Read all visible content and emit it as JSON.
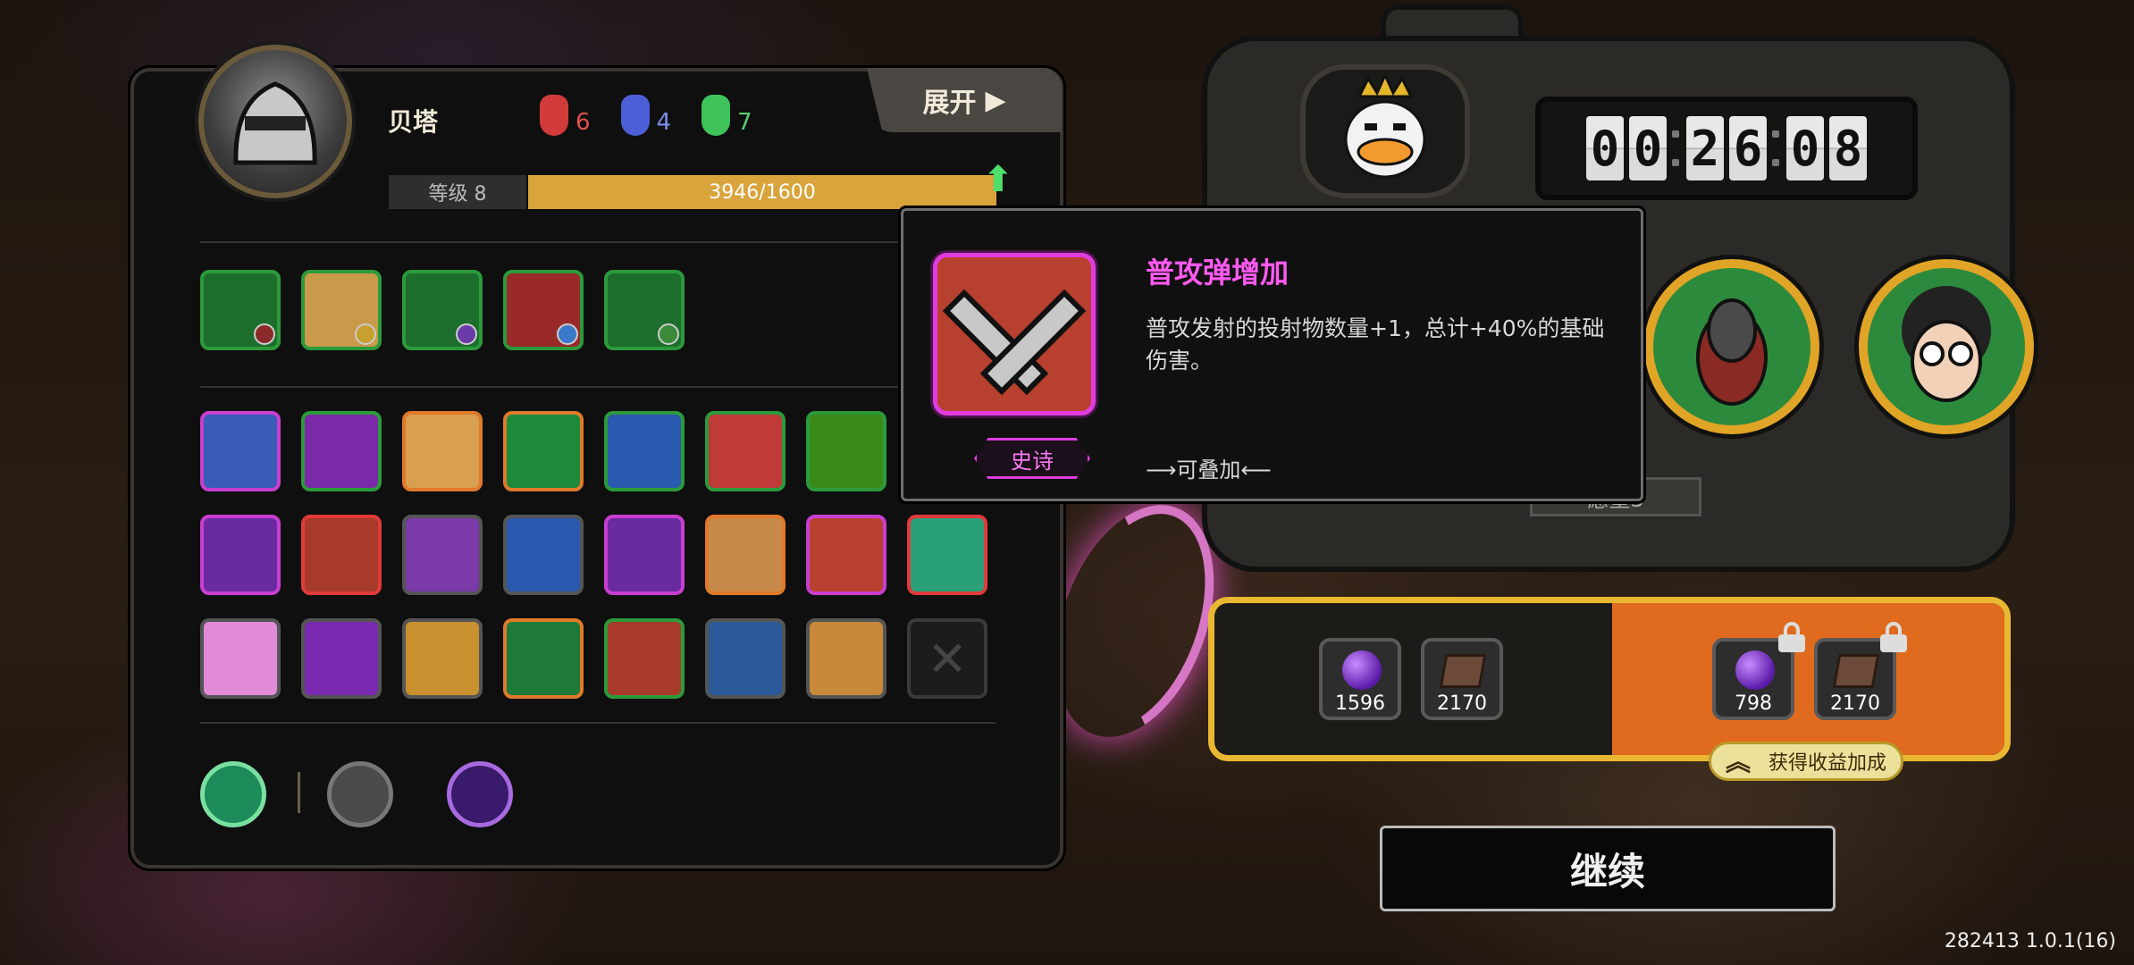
{
  "player": {
    "name": "贝塔",
    "level_label": "等级 8",
    "exp_text": "3946/1600",
    "exp_fill": 1.0
  },
  "souls": [
    {
      "color": "#d33a3a",
      "count": "6",
      "icon": "red-mask-icon"
    },
    {
      "color": "#4c5fd8",
      "count": "4",
      "icon": "blue-mask-icon"
    },
    {
      "color": "#3ec25a",
      "count": "7",
      "icon": "green-mask-icon"
    }
  ],
  "expand_label": "展开",
  "tooltip": {
    "title": "普攻弹增加",
    "description": "普攻发射的投射物数量+1，总计+40%的基础伤害。",
    "stack_label": "⟶可叠加⟵",
    "rarity": "史诗"
  },
  "timer": {
    "digits": [
      "0",
      "0",
      "2",
      "6",
      "0",
      "8"
    ]
  },
  "wish_label": "愿望3",
  "rewards": {
    "base": [
      {
        "icon": "purple-orb-icon",
        "value": "1596"
      },
      {
        "icon": "book-icon",
        "value": "2170"
      }
    ],
    "boosted": [
      {
        "icon": "purple-orb-icon",
        "value": "798"
      },
      {
        "icon": "book-icon",
        "value": "2170"
      }
    ],
    "bonus_label": "获得收益加成"
  },
  "continue_label": "继续",
  "version": "282413 1.0.1(16)"
}
